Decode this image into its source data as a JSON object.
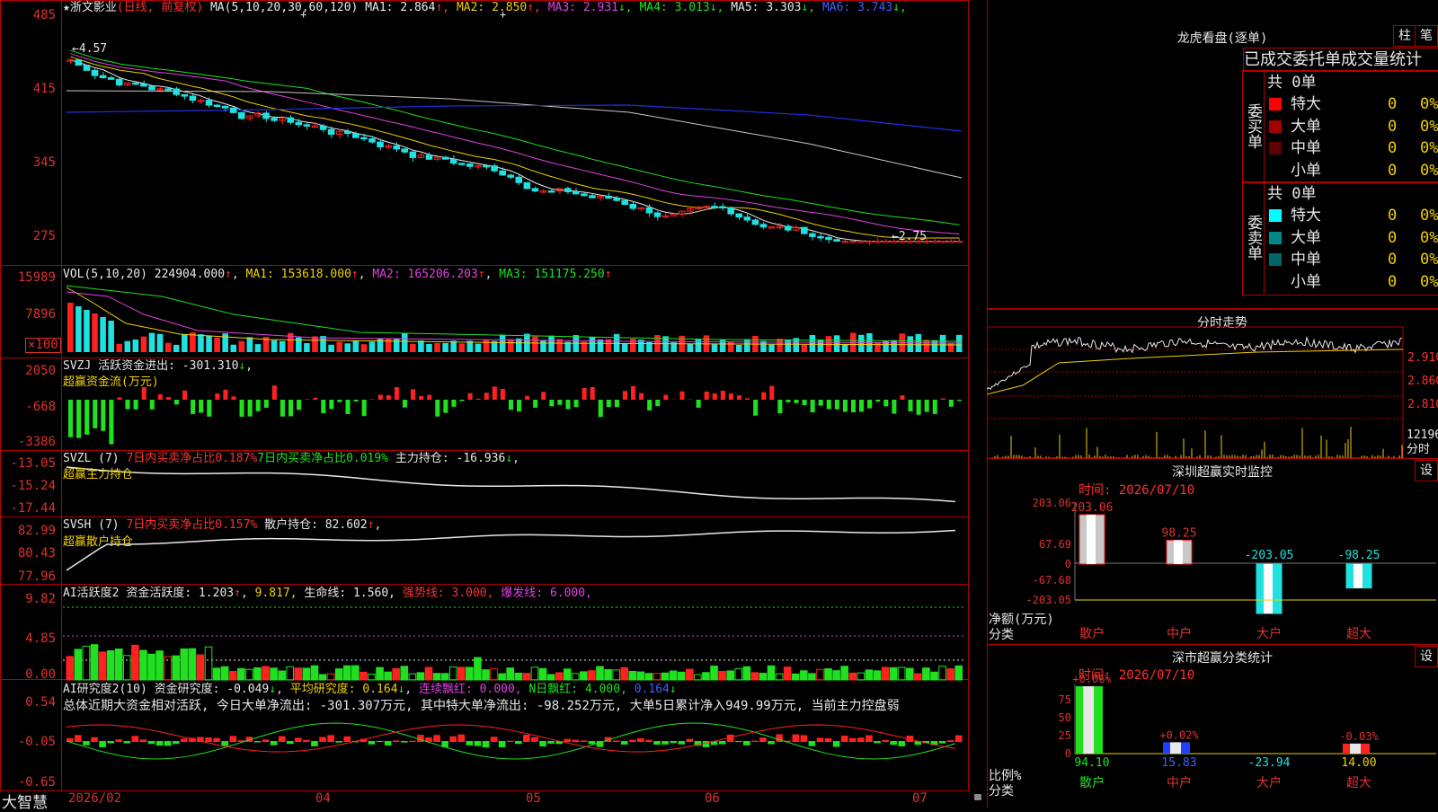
{
  "stock": {
    "name": "浙文影业",
    "star": "★",
    "period": "(日线, 前复权)",
    "ma_label": "MA(5,10,20,30,60,120)",
    "ma": [
      {
        "label": "MA1:",
        "value": "2.864",
        "dir": "↑",
        "color": "#e8e8e8"
      },
      {
        "label": "MA2:",
        "value": "2.850",
        "dir": "↑",
        "color": "#f0d000"
      },
      {
        "label": "MA3:",
        "value": "2.931",
        "dir": "↓",
        "color": "#e040e0"
      },
      {
        "label": "MA4:",
        "value": "3.013",
        "dir": "↓",
        "color": "#20e020"
      },
      {
        "label": "MA5:",
        "value": "3.303",
        "dir": "↓",
        "color": "#e8e8e8"
      },
      {
        "label": "MA6:",
        "value": "3.743",
        "dir": "↓",
        "color": "#4060ff"
      }
    ],
    "yaxis": [
      "485",
      "415",
      "345",
      "275"
    ],
    "high_mark": "4.57",
    "low_mark": "2.75"
  },
  "vol": {
    "label": "VOL(5,10,20)",
    "value": "224904.000",
    "dir": "↑",
    "ma1": "MA1: 153618.000",
    "ma2": "MA2: 165206.203",
    "ma3": "MA3: 151175.250",
    "ma_dir": "↑",
    "yaxis": [
      "15989",
      "7896",
      "×100"
    ]
  },
  "svzj": {
    "label": "SVZJ",
    "text": "活跃资金进出: -301.310",
    "dir": "↓",
    "sub": "超赢资金流(万元)",
    "yaxis": [
      "2050",
      "-668",
      "-3386"
    ]
  },
  "svzl": {
    "label": "SVZL (7)",
    "t1": "7日内买卖净占比0.187%",
    "t2": "7日内买卖净占比0.019%",
    "t3": "主力持仓: -16.936",
    "dir": "↓",
    "sub": "超赢主力持仓",
    "yaxis": [
      "-13.05",
      "-15.24",
      "-17.44"
    ]
  },
  "svsh": {
    "label": "SVSH (7)",
    "t1": "7日内买卖净占比0.157%",
    "t2": "散户持仓: 82.602",
    "dir": "↑",
    "sub": "超赢散户持仓",
    "yaxis": [
      "82.99",
      "80.43",
      "77.96"
    ]
  },
  "ai1": {
    "label": "AI活跃度2",
    "t1": "资金活跃度: 1.203",
    "t2": "9.817,",
    "t3": "生命线: 1.560,",
    "t4": "强势线: 3.000,",
    "t5": "爆发线: 6.000,",
    "yaxis": [
      "9.82",
      "4.85",
      "0.00"
    ]
  },
  "ai2": {
    "label": "AI研究度2(10)",
    "t1": "资金研究度: -0.049",
    "t2": "平均研究度: 0.164",
    "t3": "连续飘红: 0.000,",
    "t4": "N日飘红: 4.000,",
    "t5": "0.164",
    "summary": "总体近期大资金相对活跃, 今日大单净流出: -301.307万元, 其中特大单净流出: -98.252万元, 大单5日累计净入949.99万元, 当前主力控盘弱",
    "yaxis": [
      "0.54",
      "-0.05",
      "-0.65"
    ]
  },
  "xaxis": {
    "brand": "大智慧",
    "labels": [
      "2026/02",
      "04",
      "05",
      "06",
      "07"
    ]
  },
  "dragon": {
    "title": "龙虎看盘(逐单)",
    "btn1": "柱",
    "btn2": "笔",
    "heading": "已成交委托单成交量统计",
    "buy": {
      "side": "委买单",
      "total": "共 0单",
      "rows": [
        {
          "name": "特大",
          "val": "0",
          "pct": "0%",
          "color": "#ff0000"
        },
        {
          "name": "大单",
          "val": "0",
          "pct": "0%",
          "color": "#a00000"
        },
        {
          "name": "中单",
          "val": "0",
          "pct": "0%",
          "color": "#600000"
        },
        {
          "name": "小单",
          "val": "0",
          "pct": "0%",
          "color": "#000000"
        }
      ]
    },
    "sell": {
      "side": "委卖单",
      "total": "共 0单",
      "rows": [
        {
          "name": "特大",
          "val": "0",
          "pct": "0%",
          "color": "#00ffff"
        },
        {
          "name": "大单",
          "val": "0",
          "pct": "0%",
          "color": "#008888"
        },
        {
          "name": "中单",
          "val": "0",
          "pct": "0%",
          "color": "#006666"
        },
        {
          "name": "小单",
          "val": "0",
          "pct": "0%",
          "color": "#000000"
        }
      ]
    }
  },
  "intraday": {
    "title": "分时走势",
    "prices": [
      "2.910",
      "2.860",
      "2.810"
    ],
    "vol_label": "12196",
    "vol_unit": "分时"
  },
  "sz_monitor": {
    "title": "深圳超赢实时监控",
    "btn": "设",
    "time": "时间: 2026/07/10",
    "yaxis": [
      "203.06",
      "67.69",
      "0",
      "-67.68",
      "-203.05"
    ],
    "ylabel": "净额(万元)",
    "xlabel": "分类",
    "bars": [
      {
        "cat": "散户",
        "value": 203.06,
        "label": "203.06"
      },
      {
        "cat": "中户",
        "value": 98.25,
        "label": "98.25"
      },
      {
        "cat": "大户",
        "value": -203.05,
        "label": "-203.05"
      },
      {
        "cat": "超大",
        "value": -98.25,
        "label": "-98.25"
      }
    ]
  },
  "sz_class": {
    "title": "深市超赢分类统计",
    "btn": "设",
    "time": "时间: 2026/07/10",
    "yaxis": [
      "75",
      "50",
      "25",
      "0"
    ],
    "ylabel": "比例%",
    "xlabel": "分类",
    "bars": [
      {
        "cat": "散户",
        "value": 94.1,
        "label": "94.10",
        "top": "+0.06%"
      },
      {
        "cat": "中户",
        "value": 15.83,
        "label": "15.83",
        "top": "+0.02%"
      },
      {
        "cat": "大户",
        "value": -23.94,
        "label": "-23.94",
        "top": ""
      },
      {
        "cat": "超大",
        "value": 14.0,
        "label": "14.00",
        "top": "-0.03%"
      }
    ]
  }
}
